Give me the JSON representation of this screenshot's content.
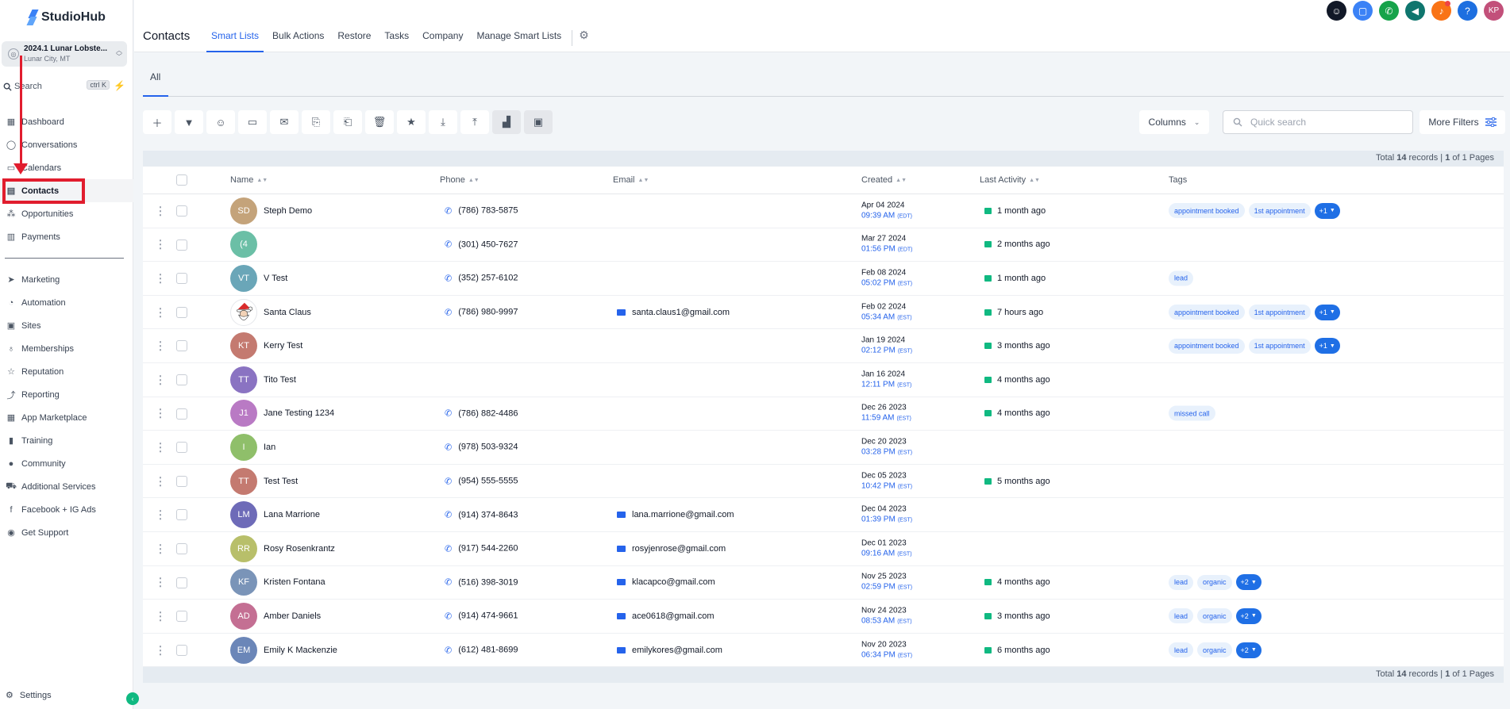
{
  "app": {
    "logo_text": "StudioHub"
  },
  "account": {
    "name": "2024.1 Lunar Lobste...",
    "location": "Lunar City, MT"
  },
  "sidebar": {
    "search_label": "Search",
    "search_shortcut": "ctrl K",
    "items_top": [
      {
        "label": "Dashboard",
        "icon": "dashboard-icon"
      },
      {
        "label": "Conversations",
        "icon": "chat-icon"
      },
      {
        "label": "Calendars",
        "icon": "calendar-icon"
      },
      {
        "label": "Contacts",
        "icon": "contacts-icon",
        "active": true
      },
      {
        "label": "Opportunities",
        "icon": "opportunities-icon"
      },
      {
        "label": "Payments",
        "icon": "payments-icon"
      }
    ],
    "items_bottom": [
      {
        "label": "Marketing",
        "icon": "send-icon"
      },
      {
        "label": "Automation",
        "icon": "automation-icon"
      },
      {
        "label": "Sites",
        "icon": "sites-icon"
      },
      {
        "label": "Memberships",
        "icon": "memberships-icon"
      },
      {
        "label": "Reputation",
        "icon": "star-icon"
      },
      {
        "label": "Reporting",
        "icon": "chart-icon"
      },
      {
        "label": "App Marketplace",
        "icon": "apps-icon"
      },
      {
        "label": "Training",
        "icon": "book-icon"
      },
      {
        "label": "Community",
        "icon": "community-icon"
      },
      {
        "label": "Additional Services",
        "icon": "cart-icon"
      },
      {
        "label": "Facebook + IG Ads",
        "icon": "facebook-icon"
      },
      {
        "label": "Get Support",
        "icon": "support-icon"
      }
    ],
    "settings_label": "Settings"
  },
  "header": {
    "title": "Contacts",
    "tabs": [
      "Smart Lists",
      "Bulk Actions",
      "Restore",
      "Tasks",
      "Company",
      "Manage Smart Lists"
    ],
    "avatar_initials": "KP"
  },
  "colors": {
    "accent": "#2563eb",
    "annotation": "#e11d2e",
    "top_icons": [
      "#111827",
      "#3b82f6",
      "#16a34a",
      "#0f766e",
      "#f97316",
      "#1d6fe0",
      "#c2507a"
    ]
  },
  "subtabs": [
    "All"
  ],
  "toolbar": {
    "columns_label": "Columns",
    "search_placeholder": "Quick search",
    "more_filters_label": "More Filters"
  },
  "pagination": {
    "text_prefix": "Total ",
    "count": "14",
    "text_mid": " records | ",
    "page": "1",
    "text_suffix": " of 1 Pages"
  },
  "table": {
    "columns": [
      "Name",
      "Phone",
      "Email",
      "Created",
      "Last Activity",
      "Tags"
    ],
    "rows": [
      {
        "initials": "SD",
        "color": "#c4a37a",
        "name": "Steph Demo",
        "phone": "(786) 783-5875",
        "email": "",
        "date": "Apr 04 2024",
        "time": "09:39 AM",
        "tz": "(EDT)",
        "activity": "1 month ago",
        "tags": [
          "appointment booked",
          "1st appointment"
        ],
        "more": "+1"
      },
      {
        "initials": "(4",
        "color": "#6bbfa6",
        "name": "",
        "phone": "(301) 450-7627",
        "email": "",
        "date": "Mar 27 2024",
        "time": "01:56 PM",
        "tz": "(EDT)",
        "activity": "2 months ago",
        "tags": [],
        "more": ""
      },
      {
        "initials": "VT",
        "color": "#6aa6b8",
        "name": "V Test",
        "phone": "(352) 257-6102",
        "email": "",
        "date": "Feb 08 2024",
        "time": "05:02 PM",
        "tz": "(EST)",
        "activity": "1 month ago",
        "tags": [
          "lead"
        ],
        "more": ""
      },
      {
        "initials": "",
        "color": "santa",
        "name": "Santa Claus",
        "phone": "(786) 980-9997",
        "email": "santa.claus1@gmail.com",
        "date": "Feb 02 2024",
        "time": "05:34 AM",
        "tz": "(EST)",
        "activity": "7 hours ago",
        "tags": [
          "appointment booked",
          "1st appointment"
        ],
        "more": "+1"
      },
      {
        "initials": "KT",
        "color": "#c47a70",
        "name": "Kerry Test",
        "phone": "",
        "email": "",
        "date": "Jan 19 2024",
        "time": "02:12 PM",
        "tz": "(EST)",
        "activity": "3 months ago",
        "tags": [
          "appointment booked",
          "1st appointment"
        ],
        "more": "+1"
      },
      {
        "initials": "TT",
        "color": "#8a73c2",
        "name": "Tito Test",
        "phone": "",
        "email": "",
        "date": "Jan 16 2024",
        "time": "12:11 PM",
        "tz": "(EST)",
        "activity": "4 months ago",
        "tags": [],
        "more": ""
      },
      {
        "initials": "J1",
        "color": "#b97ac4",
        "name": "Jane Testing 1234",
        "phone": "(786) 882-4486",
        "email": "",
        "date": "Dec 26 2023",
        "time": "11:59 AM",
        "tz": "(EST)",
        "activity": "4 months ago",
        "tags": [
          "missed call"
        ],
        "more": ""
      },
      {
        "initials": "I",
        "color": "#8fbf6a",
        "name": "Ian",
        "phone": "(978) 503-9324",
        "email": "",
        "date": "Dec 20 2023",
        "time": "03:28 PM",
        "tz": "(EST)",
        "activity": "",
        "tags": [],
        "more": ""
      },
      {
        "initials": "TT",
        "color": "#c47a70",
        "name": "Test Test",
        "phone": "(954) 555-5555",
        "email": "",
        "date": "Dec 05 2023",
        "time": "10:42 PM",
        "tz": "(EST)",
        "activity": "5 months ago",
        "tags": [],
        "more": ""
      },
      {
        "initials": "LM",
        "color": "#6e6bb8",
        "name": "Lana Marrione",
        "phone": "(914) 374-8643",
        "email": "lana.marrione@gmail.com",
        "date": "Dec 04 2023",
        "time": "01:39 PM",
        "tz": "(EST)",
        "activity": "",
        "tags": [],
        "more": ""
      },
      {
        "initials": "RR",
        "color": "#b8bf6a",
        "name": "Rosy Rosenkrantz",
        "phone": "(917) 544-2260",
        "email": "rosyjenrose@gmail.com",
        "date": "Dec 01 2023",
        "time": "09:16 AM",
        "tz": "(EST)",
        "activity": "",
        "tags": [],
        "more": ""
      },
      {
        "initials": "KF",
        "color": "#7a94b8",
        "name": "Kristen Fontana",
        "phone": "(516) 398-3019",
        "email": "klacapco@gmail.com",
        "date": "Nov 25 2023",
        "time": "02:59 PM",
        "tz": "(EST)",
        "activity": "4 months ago",
        "tags": [
          "lead",
          "organic"
        ],
        "more": "+2"
      },
      {
        "initials": "AD",
        "color": "#c46f93",
        "name": "Amber Daniels",
        "phone": "(914) 474-9661",
        "email": "ace0618@gmail.com",
        "date": "Nov 24 2023",
        "time": "08:53 AM",
        "tz": "(EST)",
        "activity": "3 months ago",
        "tags": [
          "lead",
          "organic"
        ],
        "more": "+2"
      },
      {
        "initials": "EM",
        "color": "#6b86b8",
        "name": "Emily K Mackenzie",
        "phone": "(612) 481-8699",
        "email": "emilykores@gmail.com",
        "date": "Nov 20 2023",
        "time": "06:34 PM",
        "tz": "(EST)",
        "activity": "6 months ago",
        "tags": [
          "lead",
          "organic"
        ],
        "more": "+2"
      }
    ]
  }
}
